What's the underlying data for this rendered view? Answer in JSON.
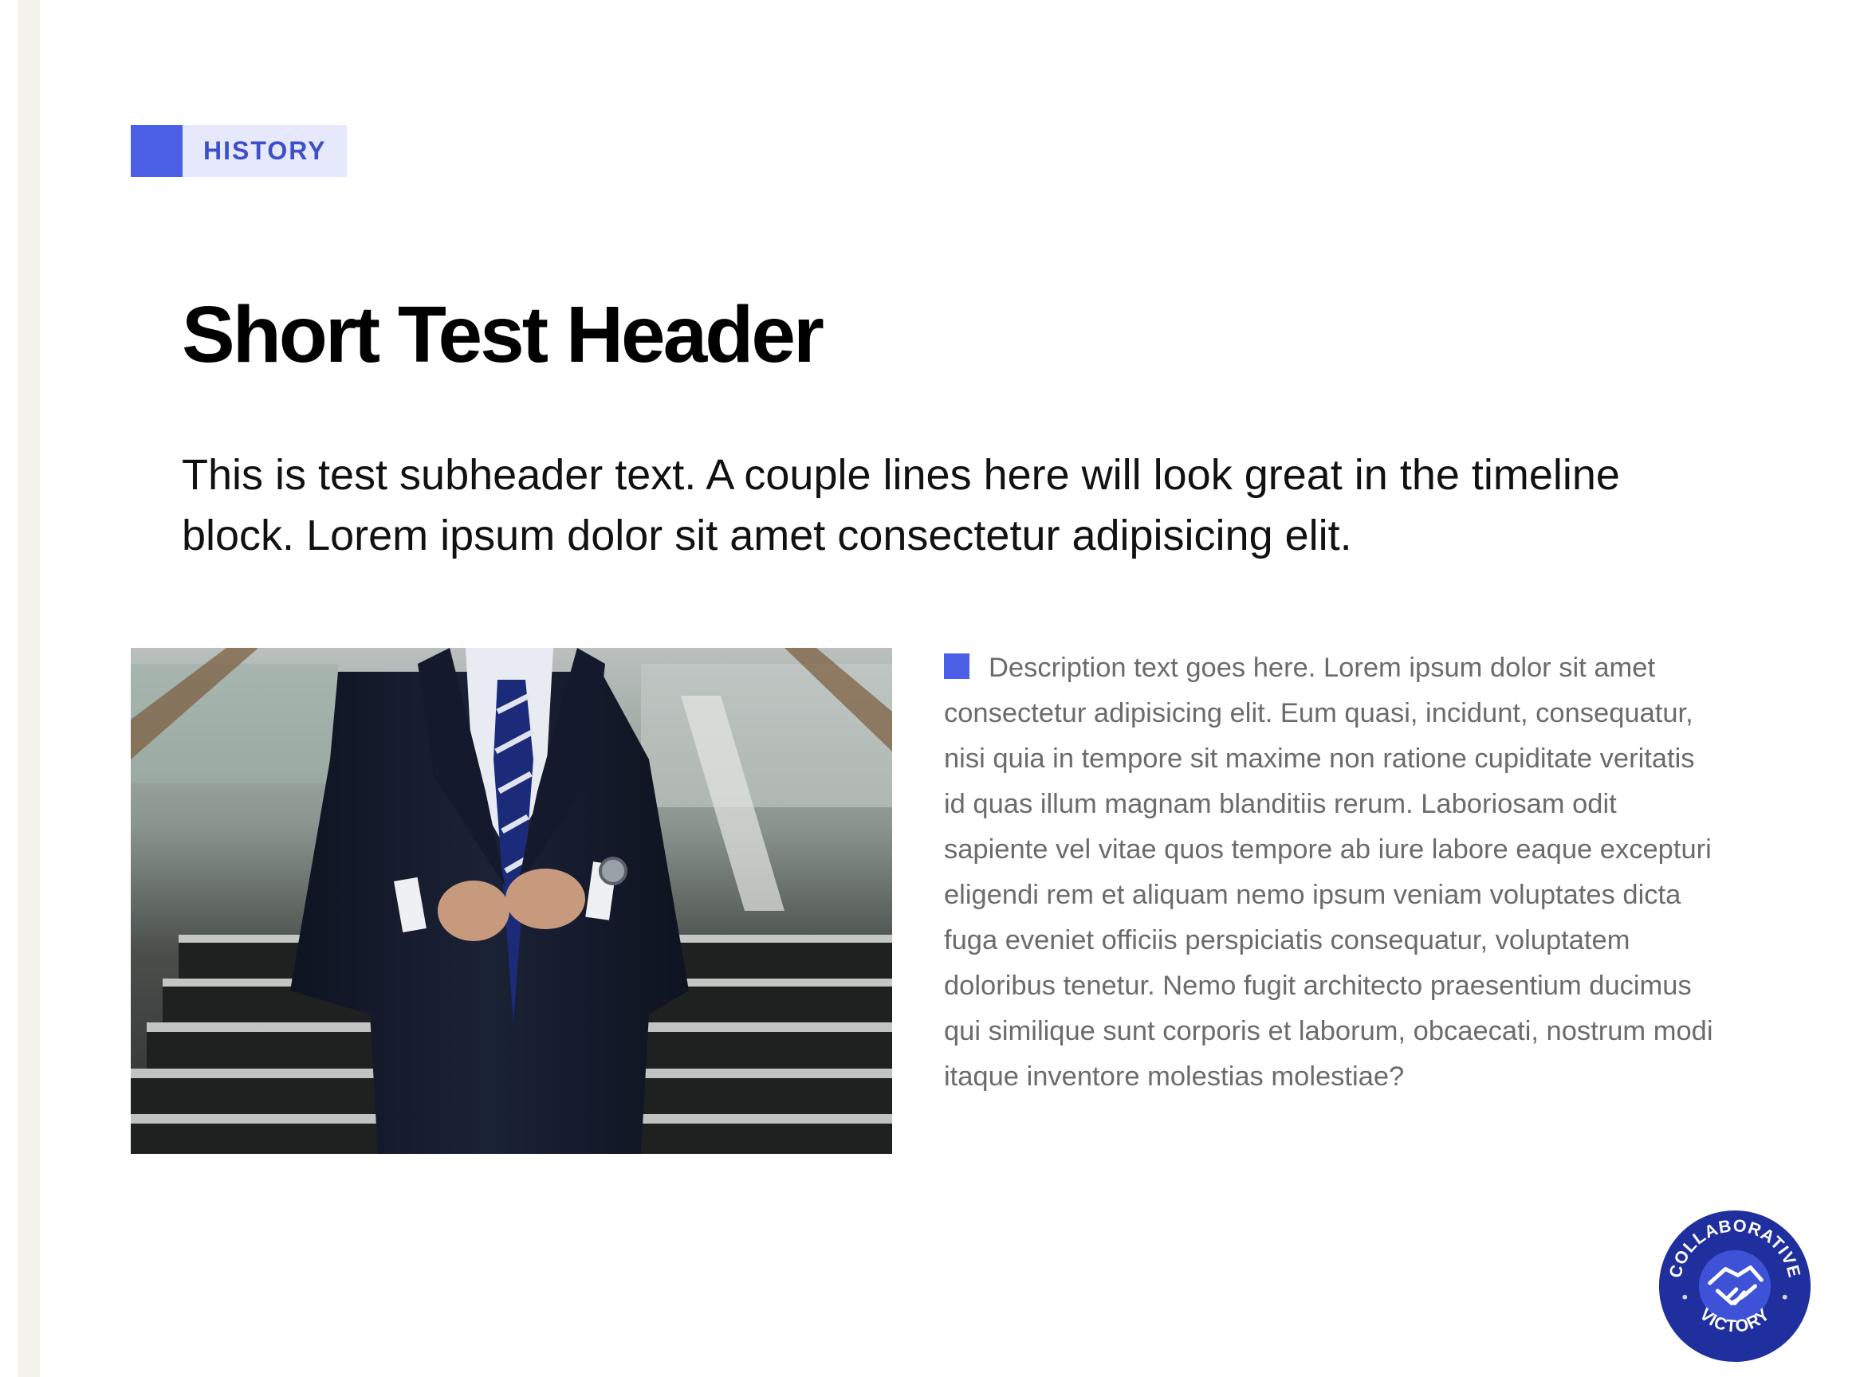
{
  "tag": {
    "label": "HISTORY"
  },
  "header": {
    "title": "Short Test Header",
    "subtitle": "This is test subheader text. A couple lines here will look great in the timeline block. Lorem ipsum dolor sit amet consectetur adipisicing elit."
  },
  "description": {
    "text": "Description text goes here. Lorem ipsum dolor sit amet consectetur adipisicing elit. Eum quasi, incidunt, consequatur, nisi quia in tempore sit maxime non ratione cupiditate veritatis id quas illum magnam blanditiis rerum. Laboriosam odit sapiente vel vitae quos tempore ab iure labore eaque excepturi eligendi rem et aliquam nemo ipsum veniam voluptates dicta fuga eveniet officiis perspiciatis consequatur, voluptatem doloribus tenetur. Nemo fugit architecto praesentium ducimus qui similique sunt corporis et laborum, obcaecati, nostrum modi itaque inventore molestias molestiae?"
  },
  "badge": {
    "top_text": "COLLABORATIVE",
    "bottom_text": "VICTORY",
    "icon": "handshake-icon"
  },
  "colors": {
    "accent": "#4a5ee6",
    "tag_bg": "#e6e9fb",
    "badge": "#1f2f9e",
    "rail": "#f3f3ec"
  }
}
